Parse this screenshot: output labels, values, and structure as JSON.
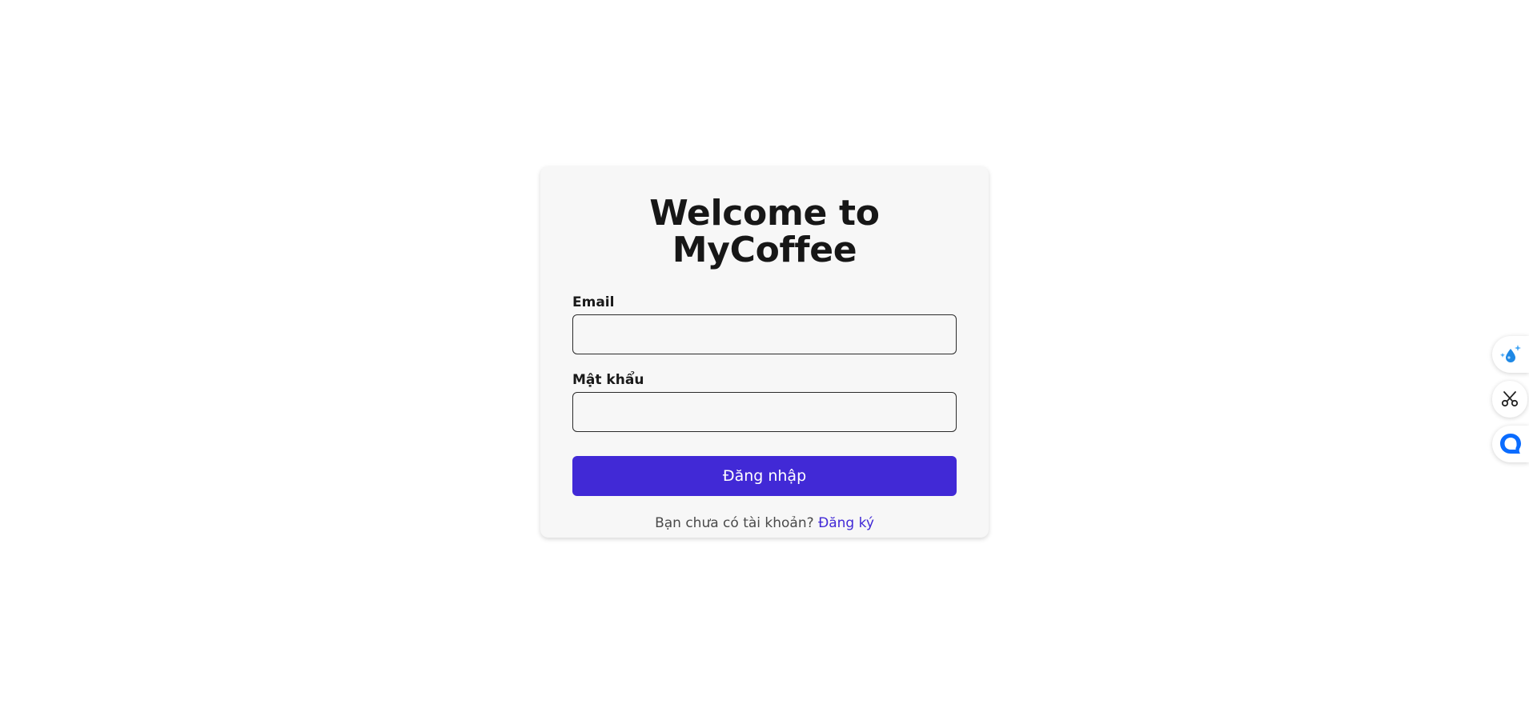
{
  "login_card": {
    "title": "Welcome to MyCoffee",
    "email_label": "Email",
    "email_value": "",
    "password_label": "Mật khẩu",
    "password_value": "",
    "submit_label": "Đăng nhập",
    "signup_prompt": "Bạn chưa có tài khoản?",
    "signup_link": "Đăng ký"
  },
  "side_tools": [
    {
      "icon": "sparkle-drop-icon"
    },
    {
      "icon": "scissors-icon"
    },
    {
      "icon": "chat-bubble-icon"
    }
  ],
  "colors": {
    "accent": "#4129d6",
    "card_background": "#f7f7f7",
    "page_background": "#ffffff"
  }
}
